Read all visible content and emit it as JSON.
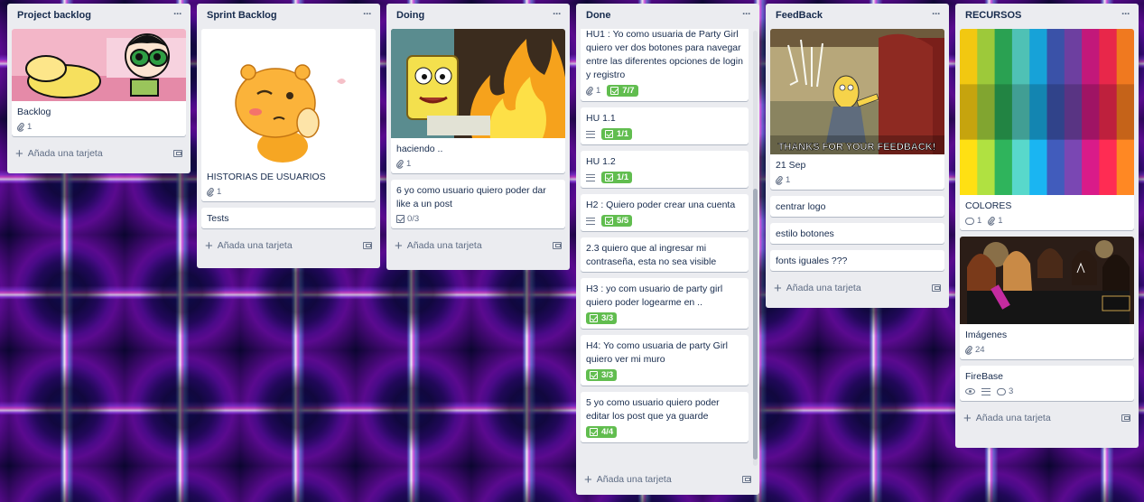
{
  "lists": [
    {
      "title": "Project backlog",
      "cards": [
        {
          "title": "Backlog",
          "attachments": "1"
        }
      ],
      "add_card": "Añada una tarjeta"
    },
    {
      "title": "Sprint Backlog",
      "cards": [
        {
          "title": "HISTORIAS DE USUARIOS",
          "attachments": "1"
        },
        {
          "title": "Tests"
        }
      ],
      "add_card": "Añada una tarjeta"
    },
    {
      "title": "Doing",
      "cards": [
        {
          "title": "haciendo ..",
          "attachments": "1"
        },
        {
          "title": "6 yo como usuario quiero poder dar like a un post",
          "checklist": "0/3"
        }
      ],
      "add_card": "Añada una tarjeta"
    },
    {
      "title": "Done",
      "cards": [
        {
          "title": "HU1 : Yo como usuaria de Party Girl quiero ver dos botones para navegar entre las diferentes opciones de login y registro",
          "attachments": "1",
          "checklist": "7/7"
        },
        {
          "title": "HU 1.1",
          "checklist": "1/1"
        },
        {
          "title": "HU 1.2",
          "checklist": "1/1"
        },
        {
          "title": "H2 : Quiero poder crear una cuenta",
          "checklist": "5/5"
        },
        {
          "title": "2.3 quiero que al ingresar mi contraseña, esta no sea visible"
        },
        {
          "title": "H3 : yo com usuario de party girl quiero poder logearme en ..",
          "checklist": "3/3"
        },
        {
          "title": "H4: Yo como usuaria de party Girl quiero ver mi muro",
          "checklist": "3/3"
        },
        {
          "title": "5 yo como usuario quiero poder editar los post que ya guarde",
          "checklist": "4/4"
        }
      ],
      "add_card": "Añada una tarjeta"
    },
    {
      "title": "FeedBack",
      "cards": [
        {
          "title": "21 Sep",
          "attachments": "1",
          "cover_caption": "THANKS FOR YOUR FEEDBACK!"
        },
        {
          "title": "centrar logo"
        },
        {
          "title": "estilo botones"
        },
        {
          "title": "fonts iguales ???"
        }
      ],
      "add_card": "Añada una tarjeta"
    },
    {
      "title": "RECURSOS",
      "cards": [
        {
          "title": "COLORES",
          "comments": "1",
          "attachments": "1"
        },
        {
          "title": "Imágenes",
          "attachments": "24"
        },
        {
          "title": "FireBase",
          "comments": "3"
        }
      ],
      "add_card": "Añada una tarjeta"
    }
  ],
  "palette": [
    "#f2c811",
    "#9dc93a",
    "#2aa152",
    "#4fc1b5",
    "#17a2d8",
    "#3a52a8",
    "#6d3fa0",
    "#c2187a",
    "#e8274a",
    "#f0791f"
  ],
  "accent": {
    "checklist_done": "#61bd4f",
    "list_bg": "#ebecf0"
  }
}
